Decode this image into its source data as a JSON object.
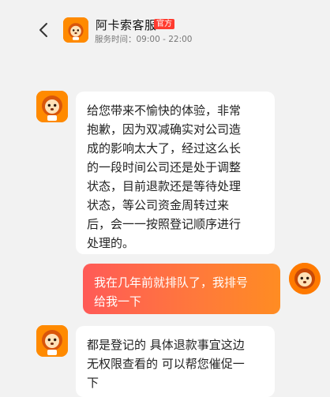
{
  "header": {
    "title": "阿卡索客服",
    "badge": "官方",
    "service_hours": "服务时间：09:00 - 22:00"
  },
  "messages": [
    {
      "sender": "agent",
      "text": "给您带来不愉快的体验，非常\n抱歉，因为双减确实对公司造\n成的影响太大了，经过这么长\n的一段时间公司还是处于调整\n状态，目前退款还是等待处理\n状态，等公司资金周转过来\n后，会一一按照登记顺序进行\n处理的。"
    },
    {
      "sender": "user",
      "text": "我在几年前就排队了，我排号\n给我一下"
    },
    {
      "sender": "agent",
      "text": "都是登记的  具体退款事宜这边\n无权限查看的 可以帮您催促一\n下"
    }
  ],
  "colors": {
    "brand": "#ff8a00",
    "badge": "#ff3b2f",
    "user_bubble_start": "#ff5a57",
    "user_bubble_end": "#ff8c22"
  }
}
